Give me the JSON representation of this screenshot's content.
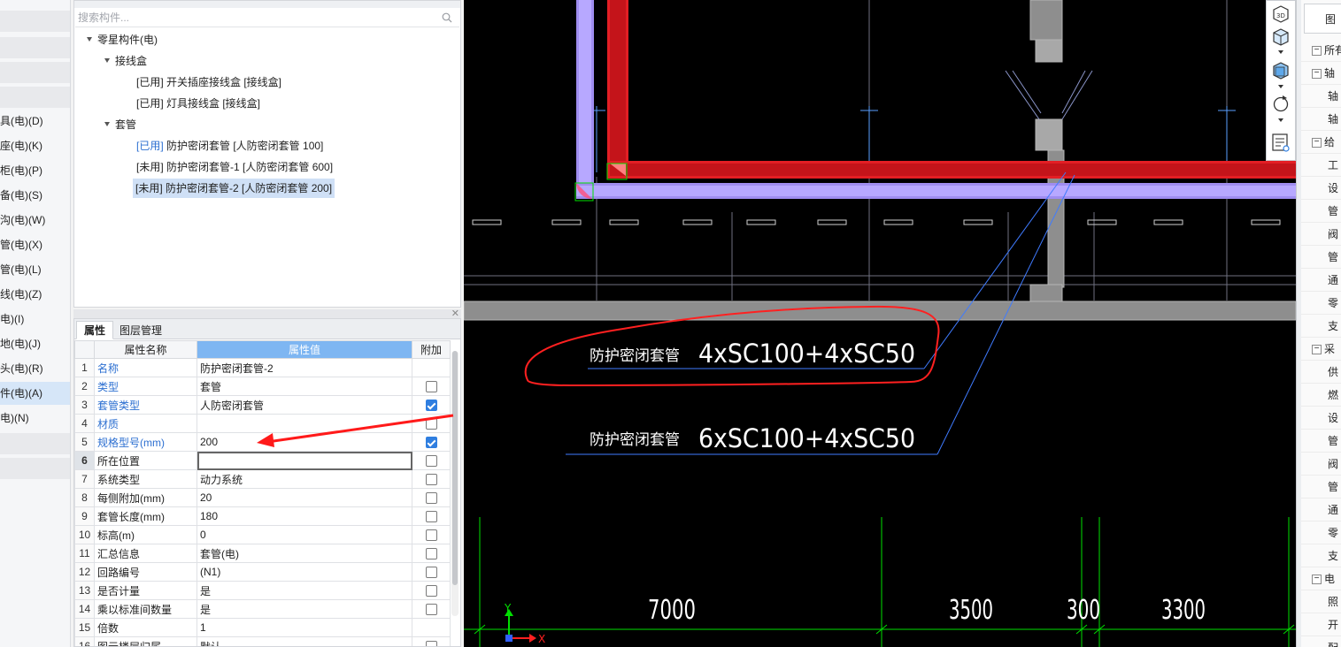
{
  "left_rail": {
    "items": [
      {
        "label": "具(电)(D)",
        "active": false
      },
      {
        "label": "座(电)(K)",
        "active": false
      },
      {
        "label": "柜(电)(P)",
        "active": false
      },
      {
        "label": "备(电)(S)",
        "active": false
      },
      {
        "label": "沟(电)(W)",
        "active": false
      },
      {
        "label": "管(电)(X)",
        "active": false
      },
      {
        "label": "管(电)(L)",
        "active": false
      },
      {
        "label": "线(电)(Z)",
        "active": false
      },
      {
        "label": "电)(I)",
        "active": false
      },
      {
        "label": "地(电)(J)",
        "active": false
      },
      {
        "label": "头(电)(R)",
        "active": false
      },
      {
        "label": "件(电)(A)",
        "active": true
      },
      {
        "label": "电)(N)",
        "active": false
      }
    ]
  },
  "component_tree": {
    "search_placeholder": "搜索构件...",
    "root": "零星构件(电)",
    "groups": [
      {
        "label": "接线盒",
        "items": [
          {
            "status": "[已用]",
            "name": "开关插座接线盒 [接线盒]",
            "status_blue": false,
            "selected": false
          },
          {
            "status": "[已用]",
            "name": "灯具接线盒 [接线盒]",
            "status_blue": false,
            "selected": false
          }
        ]
      },
      {
        "label": "套管",
        "items": [
          {
            "status": "[已用]",
            "name": "防护密闭套管 [人防密闭套管 100]",
            "status_blue": true,
            "selected": false
          },
          {
            "status": "[未用]",
            "name": "防护密闭套管-1 [人防密闭套管 600]",
            "status_blue": false,
            "selected": false
          },
          {
            "status": "[未用]",
            "name": "防护密闭套管-2 [人防密闭套管 200]",
            "status_blue": false,
            "selected": true
          }
        ]
      }
    ]
  },
  "properties": {
    "tabs": [
      "属性",
      "图层管理"
    ],
    "active_tab": "属性",
    "headers": {
      "name": "属性名称",
      "value": "属性值",
      "extra": "附加"
    },
    "rows": [
      {
        "n": "1",
        "name": "名称",
        "value": "防护密闭套管-2",
        "blue": true,
        "checkbox": null
      },
      {
        "n": "2",
        "name": "类型",
        "value": "套管",
        "blue": true,
        "checkbox": false
      },
      {
        "n": "3",
        "name": "套管类型",
        "value": "人防密闭套管",
        "blue": true,
        "checkbox": true
      },
      {
        "n": "4",
        "name": "材质",
        "value": "",
        "blue": true,
        "checkbox": false
      },
      {
        "n": "5",
        "name": "规格型号(mm)",
        "value": "200",
        "blue": true,
        "checkbox": true
      },
      {
        "n": "6",
        "name": "所在位置",
        "value": "",
        "blue": false,
        "checkbox": false,
        "editing": true
      },
      {
        "n": "7",
        "name": "系统类型",
        "value": "动力系统",
        "blue": false,
        "checkbox": false
      },
      {
        "n": "8",
        "name": "每侧附加(mm)",
        "value": "20",
        "blue": false,
        "checkbox": false
      },
      {
        "n": "9",
        "name": "套管长度(mm)",
        "value": "180",
        "blue": false,
        "checkbox": false
      },
      {
        "n": "10",
        "name": "标高(m)",
        "value": "0",
        "blue": false,
        "checkbox": false
      },
      {
        "n": "11",
        "name": "汇总信息",
        "value": "套管(电)",
        "blue": false,
        "checkbox": false
      },
      {
        "n": "12",
        "name": "回路编号",
        "value": "(N1)",
        "blue": false,
        "checkbox": false
      },
      {
        "n": "13",
        "name": "是否计量",
        "value": "是",
        "blue": false,
        "checkbox": false
      },
      {
        "n": "14",
        "name": "乘以标准间数量",
        "value": "是",
        "blue": false,
        "checkbox": false
      },
      {
        "n": "15",
        "name": "倍数",
        "value": "1",
        "blue": false,
        "checkbox": null
      },
      {
        "n": "16",
        "name": "图元楼层归属",
        "value": "默认",
        "blue": false,
        "checkbox": false
      }
    ]
  },
  "cad": {
    "annotation_1": {
      "label": "防护密闭套管",
      "spec": "4xSC100+4xSC50"
    },
    "annotation_2": {
      "label": "防护密闭套管",
      "spec": "6xSC100+4xSC50"
    },
    "dimensions": [
      "7000",
      "3500",
      "300",
      "3300"
    ],
    "axis_y": "Y",
    "axis_x": "X",
    "colors": {
      "background": "#000000",
      "pipe": "#e31e24",
      "tray": "#9f8df0",
      "wall": "#8e8e8e",
      "dim_line": "#00e000",
      "highlight": "#ff2020"
    }
  },
  "view_toolbar": {
    "icons": [
      "3d-view-icon",
      "cube-top-icon",
      "cube-front-icon",
      "rotate-icon",
      "layer-list-icon"
    ],
    "label_3d": "3D"
  },
  "right_panel": {
    "top_label": "图",
    "rows": [
      {
        "type": "group",
        "label": "所有"
      },
      {
        "type": "group",
        "label": "轴"
      },
      {
        "type": "child",
        "label": "轴"
      },
      {
        "type": "child",
        "label": "轴"
      },
      {
        "type": "group",
        "label": "给"
      },
      {
        "type": "child",
        "label": "工"
      },
      {
        "type": "child",
        "label": "设"
      },
      {
        "type": "child",
        "label": "管"
      },
      {
        "type": "child",
        "label": "阀"
      },
      {
        "type": "child",
        "label": "管"
      },
      {
        "type": "child",
        "label": "通"
      },
      {
        "type": "child",
        "label": "零"
      },
      {
        "type": "child",
        "label": "支"
      },
      {
        "type": "group",
        "label": "采"
      },
      {
        "type": "child",
        "label": "供"
      },
      {
        "type": "child",
        "label": "燃"
      },
      {
        "type": "child",
        "label": "设"
      },
      {
        "type": "child",
        "label": "管"
      },
      {
        "type": "child",
        "label": "阀"
      },
      {
        "type": "child",
        "label": "管"
      },
      {
        "type": "child",
        "label": "通"
      },
      {
        "type": "child",
        "label": "零"
      },
      {
        "type": "child",
        "label": "支"
      },
      {
        "type": "group",
        "label": "电"
      },
      {
        "type": "child",
        "label": "照"
      },
      {
        "type": "child",
        "label": "开"
      },
      {
        "type": "child",
        "label": "配"
      }
    ]
  }
}
